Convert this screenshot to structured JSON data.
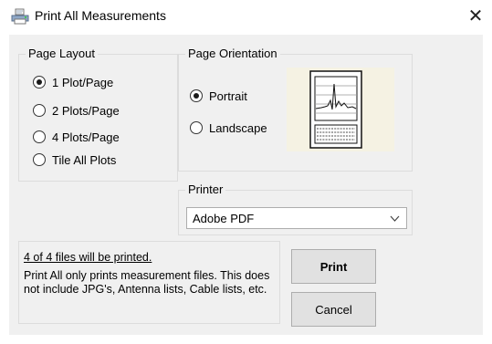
{
  "window": {
    "title": "Print All Measurements",
    "icon": "printer-icon",
    "close_glyph": "✕"
  },
  "page_layout": {
    "label": "Page Layout",
    "options": [
      {
        "label": "1 Plot/Page",
        "checked": true
      },
      {
        "label": "2 Plots/Page",
        "checked": false
      },
      {
        "label": "4 Plots/Page",
        "checked": false
      },
      {
        "label": "Tile All Plots",
        "checked": false
      }
    ]
  },
  "page_orientation": {
    "label": "Page Orientation",
    "options": [
      {
        "label": "Portrait",
        "checked": true
      },
      {
        "label": "Landscape",
        "checked": false
      }
    ],
    "preview_icon": "portrait-page-preview-icon"
  },
  "printer": {
    "label": "Printer",
    "selected": "Adobe PDF"
  },
  "info": {
    "count_text": "4 of 4 files will be printed.",
    "note": "Print All only prints measurement files. This does not include JPG's, Antenna lists, Cable lists, etc."
  },
  "buttons": {
    "print": "Print",
    "cancel": "Cancel"
  }
}
